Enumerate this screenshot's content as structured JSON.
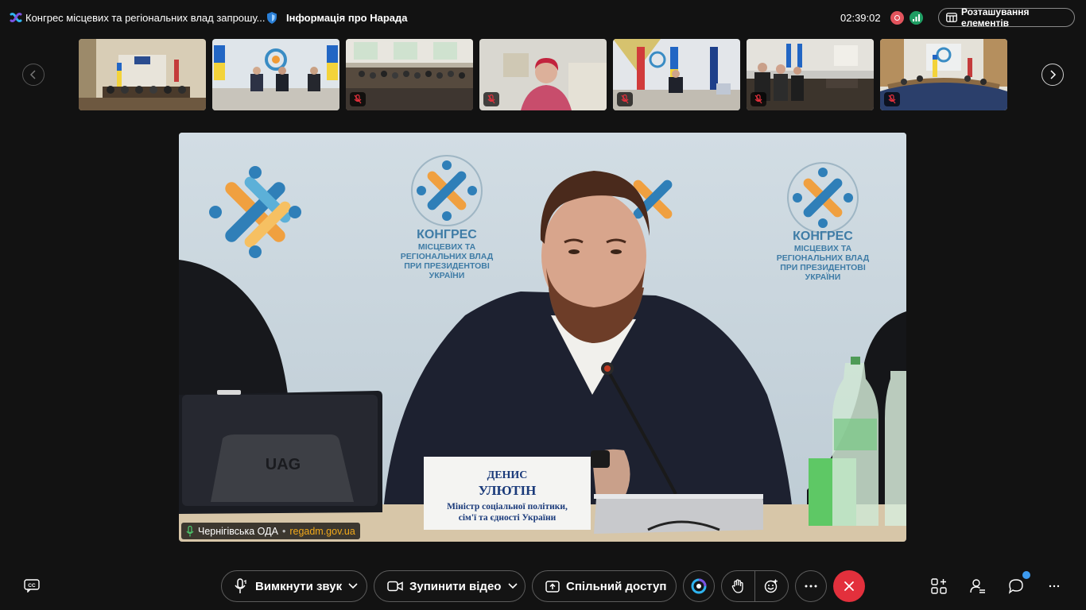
{
  "header": {
    "meeting_title": "Конгрес місцевих та регіональних влад запрошу...",
    "info_label": "Інформація про Нарада",
    "timer": "02:39:02",
    "layout_button": "Розташування елементів"
  },
  "colors": {
    "background": "#121212",
    "accent_blue": "#3d9bf0",
    "end_call_red": "#e3303c",
    "recording_red": "#e2545d",
    "signal_green": "#1f9d63",
    "source_orange": "#f2a91a"
  },
  "filmstrip": {
    "participants": [
      {
        "muted": false
      },
      {
        "muted": false
      },
      {
        "muted": true
      },
      {
        "muted": true
      },
      {
        "muted": true
      },
      {
        "muted": true
      },
      {
        "muted": true
      }
    ]
  },
  "main_video": {
    "backdrop_text": [
      "КОНГРЕС",
      "МІСЦЕВИХ ТА",
      "РЕГІОНАЛЬНИХ ВЛАД",
      "ПРИ ПРЕЗИДЕНТОВІ",
      "УКРАЇНИ"
    ],
    "laptop_brand": "UAG",
    "nameplate": {
      "first_name": "ДЕНИС",
      "last_name": "УЛЮТІН",
      "position_line1": "Міністр соціальної політики,",
      "position_line2": "сім'ї та єдності України"
    },
    "name_tag": {
      "participant": "Чернігівська ОДА",
      "separator": "•",
      "source": "regadm.gov.ua"
    }
  },
  "controls": {
    "mute_label": "Вимкнути звук",
    "video_label": "Зупинити відео",
    "share_label": "Спільний доступ"
  }
}
